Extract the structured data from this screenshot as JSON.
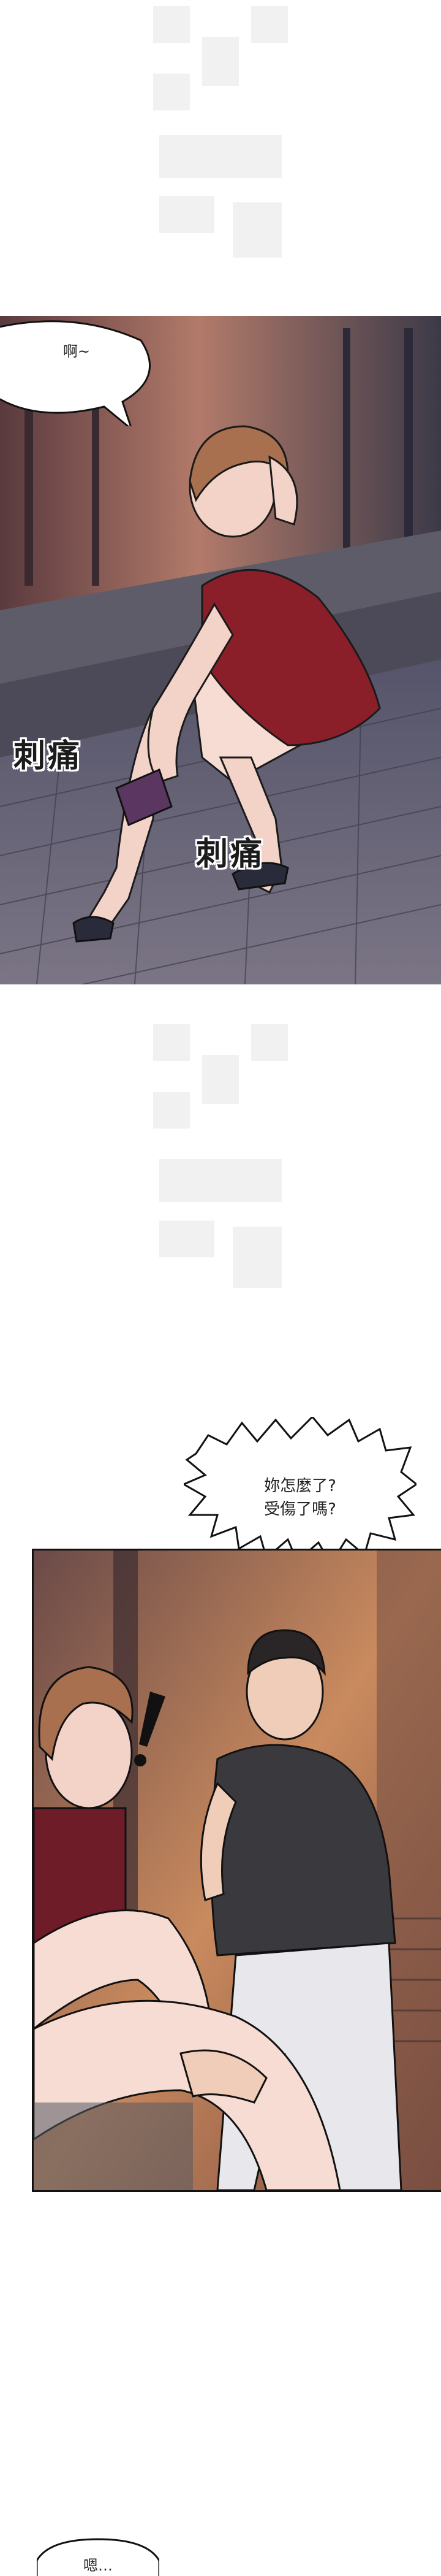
{
  "panel1": {
    "speech": "啊~",
    "sfx_left": "刺痛",
    "sfx_right": "刺痛"
  },
  "panel2": {
    "speech_line1": "妳怎麼了?",
    "speech_line2": "受傷了嗎?"
  },
  "panel3": {
    "speech": "嗯…"
  },
  "colors": {
    "background": "#ffffff",
    "outline": "#111111",
    "floor": "#6e6a78",
    "dress": "#8a1f2a"
  }
}
